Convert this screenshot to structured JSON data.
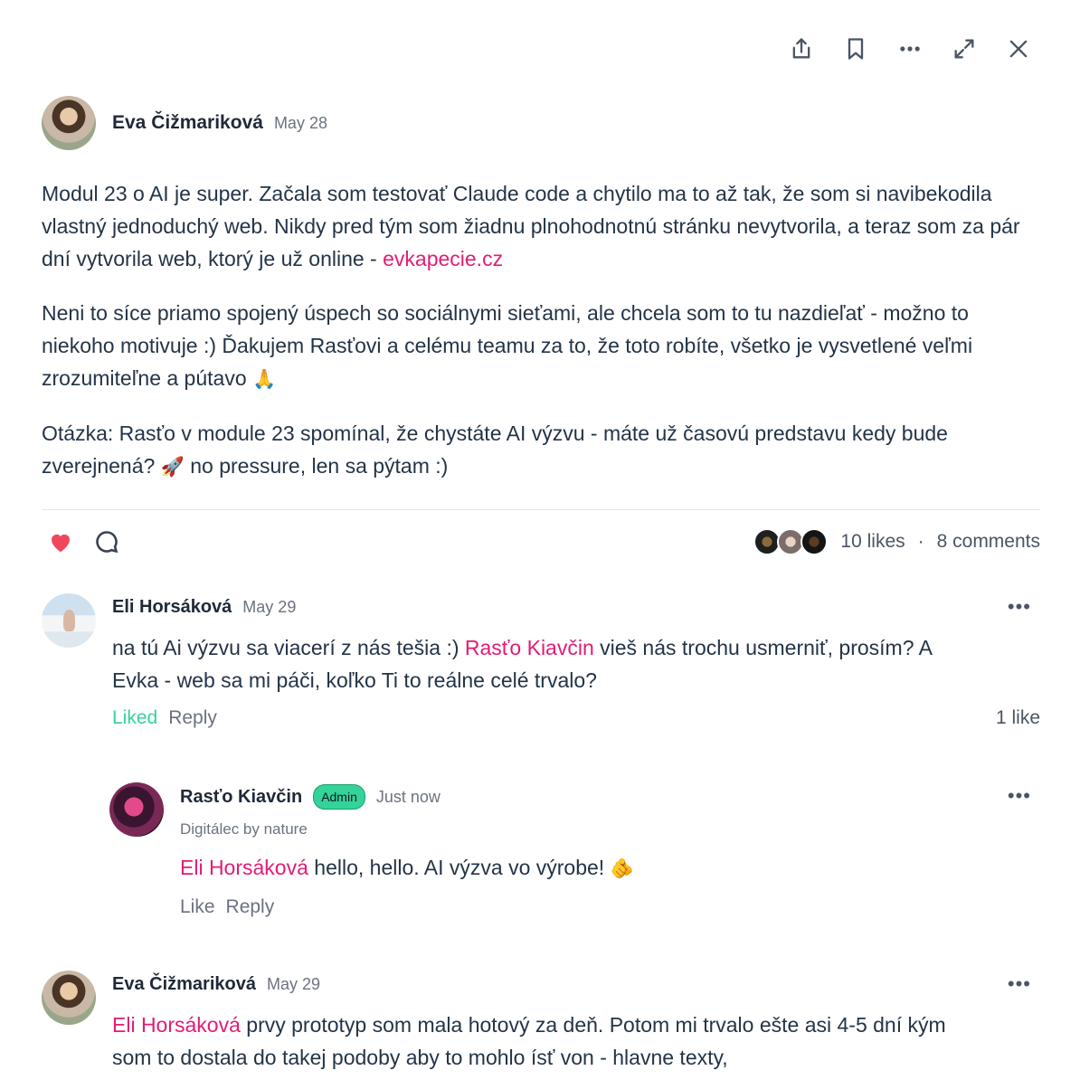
{
  "toolbar": {
    "icons": [
      "share-icon",
      "bookmark-icon",
      "more-icon",
      "expand-icon",
      "close-icon"
    ]
  },
  "post": {
    "author": "Eva Čižmariková",
    "date": "May 28",
    "paragraphs": {
      "p1": "Modul 23 o AI je super. Začala som testovať Claude code a chytilo ma to až tak, že som si navibekodila vlastný jednoduchý web. Nikdy pred tým som žiadnu plnohodnotnú stránku nevytvorila, a teraz som za pár dní vytvorila web, ktorý je už online - ",
      "p1_link": "evkapecie.cz",
      "p2": "Neni to síce priamo spojený úspech so sociálnymi sieťami, ale chcela som to tu nazdieľať - možno to niekoho motivuje :) Ďakujem Rasťovi a celému teamu za to, že toto robíte, všetko je vysvetlené veľmi zrozumiteľne a pútavo ",
      "p2_emoji": "🙏",
      "p3_a": "Otázka: Rasťo v module 23 spomínal, že chystáte AI výzvu - máte už časovú predstavu kedy bude zverejnená? ",
      "p3_emoji": "🚀",
      "p3_b": " no pressure, len sa pýtam :)"
    },
    "likes": "10 likes",
    "separator": "·",
    "comments": "8 comments",
    "accent": "#e11d74",
    "heart_color": "#f0475b"
  },
  "comments": [
    {
      "author": "Eli Horsáková",
      "date": "May 29",
      "text_a": "na tú Ai výzvu sa viacerí z nás tešia :) ",
      "mention": "Rasťo Kiavčin",
      "text_b": " vieš nás trochu usmerniť, prosím? A Evka - web sa mi páči, koľko Ti to reálne celé trvalo?",
      "liked_label": "Liked",
      "reply_label": "Reply",
      "like_count": "1 like"
    },
    {
      "author": "Rasťo Kiavčin",
      "badge": "Admin",
      "date": "Just now",
      "subtitle": "Digitálec by nature",
      "mention": "Eli Horsáková",
      "text": " hello, hello. AI výzva vo výrobe! ",
      "emoji": "🫵",
      "like_label": "Like",
      "reply_label": "Reply"
    },
    {
      "author": "Eva Čižmariková",
      "date": "May 29",
      "mention": "Eli Horsáková",
      "text": " prvy prototyp som mala hotový za deň. Potom mi trvalo ešte asi 4-5 dní kým som to dostala do takej podoby aby to mohlo ísť von - hlavne texty,"
    }
  ]
}
